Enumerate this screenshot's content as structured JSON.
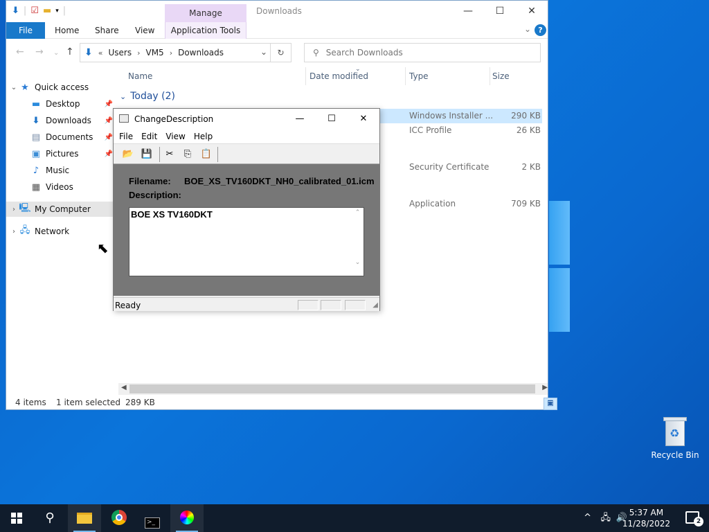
{
  "explorer": {
    "manage_tab": "Manage",
    "title": "Downloads",
    "ribbon_tabs": {
      "file": "File",
      "home": "Home",
      "share": "Share",
      "view": "View",
      "app_tools": "Application Tools"
    },
    "address": {
      "crumbs": [
        "Users",
        "VM5",
        "Downloads"
      ]
    },
    "search": {
      "placeholder": "Search Downloads"
    },
    "nav": {
      "quick_access": "Quick access",
      "desktop": "Desktop",
      "downloads": "Downloads",
      "documents": "Documents",
      "pictures": "Pictures",
      "music": "Music",
      "videos": "Videos",
      "my_computer": "My Computer",
      "network": "Network"
    },
    "columns": {
      "name": "Name",
      "date": "Date modified",
      "type": "Type",
      "size": "Size"
    },
    "group": "Today (2)",
    "rows": [
      {
        "type": "Windows Installer ...",
        "size": "290 KB"
      },
      {
        "type": "ICC Profile",
        "size": "26 KB"
      },
      {
        "type": "Security Certificate",
        "size": "2 KB"
      },
      {
        "type": "Application",
        "size": "709 KB"
      }
    ],
    "status": {
      "items": "4 items",
      "selected": "1 item selected",
      "size": "289 KB"
    }
  },
  "dialog": {
    "title": "ChangeDescription",
    "menu": {
      "file": "File",
      "edit": "Edit",
      "view": "View",
      "help": "Help"
    },
    "filename_label": "Filename:",
    "filename": "BOE_XS_TV160DKT_NH0_calibrated_01.icm",
    "description_label": "Description:",
    "description": "BOE XS TV160DKT",
    "status": "Ready"
  },
  "desktop": {
    "recycle_bin": "Recycle Bin"
  },
  "taskbar": {
    "time": "5:37 AM",
    "date": "11/28/2022",
    "notifications": "2"
  },
  "colors": {
    "accent": "#1979ca",
    "manage_tab": "#e9d8f6",
    "taskbar": "#101c2c",
    "selection": "#cce8ff"
  }
}
